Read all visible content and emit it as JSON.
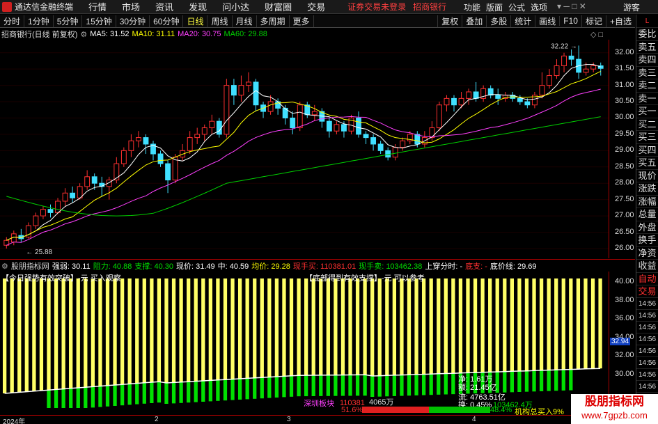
{
  "titlebar": {
    "app_name": "通达信金融终端",
    "menus": [
      "行情",
      "市场",
      "资讯",
      "发现",
      "问小达",
      "财富圈",
      "交易"
    ],
    "notice1": "证券交易未登录",
    "notice2": "招商银行",
    "right_menus": [
      "功能",
      "版面",
      "公式",
      "选项"
    ],
    "guest": "游客"
  },
  "toolbar": {
    "periods": [
      "分时",
      "1分钟",
      "5分钟",
      "15分钟",
      "30分钟",
      "60分钟",
      "日线",
      "周线",
      "月线",
      "多周期",
      "更多"
    ],
    "active_period": "日线",
    "tools": [
      "复权",
      "叠加",
      "多股",
      "统计",
      "画线",
      "F10",
      "标记",
      "+自选"
    ]
  },
  "stock": {
    "title": "招商银行(日线 前复权)",
    "ma5_label": "MA5: 31.52",
    "ma10_label": "MA10: 31.11",
    "ma20_label": "MA20: 30.75",
    "ma60_label": "MA60: 29.88",
    "high_mark": "32.22",
    "low_mark": "25.88"
  },
  "colors": {
    "ma5": "#ffffff",
    "ma10": "#ffff00",
    "ma20": "#ff40ff",
    "ma60": "#00d000",
    "up": "#ff3030",
    "down": "#40e0ff",
    "bar_yellow": "#ffff66",
    "bar_green": "#00e000"
  },
  "price_axis": [
    "32.00",
    "31.50",
    "31.00",
    "30.50",
    "30.00",
    "29.50",
    "29.00",
    "28.50",
    "28.00",
    "27.50",
    "27.00",
    "26.50",
    "26.00"
  ],
  "indicator": {
    "name": "股朋指标网",
    "items": [
      {
        "text": "强弱: 30.11",
        "color": "#ffffff"
      },
      {
        "text": "阻力: 40.88",
        "color": "#00e000"
      },
      {
        "text": "支撑: 40.30",
        "color": "#00e000"
      },
      {
        "text": "现价: 31.49",
        "color": "#ffffff"
      },
      {
        "text": "中: 40.59",
        "color": "#ffffff"
      },
      {
        "text": "均价: 29.28",
        "color": "#ffff00"
      },
      {
        "text": "现手买: 110381.01",
        "color": "#ff3030"
      },
      {
        "text": "现手卖: 103462.38",
        "color": "#00e000"
      },
      {
        "text": "上穿分时: -",
        "color": "#ffffff"
      },
      {
        "text": "底支: -",
        "color": "#ff3030"
      },
      {
        "text": "底价线: 29.69",
        "color": "#ffffff"
      }
    ],
    "caption_left": "【今日强势有效突破】-元 买入观察",
    "caption_right": "【底部得到有效支撑】-元 可以参考",
    "current_value": "32.94",
    "axis": [
      "40.00",
      "38.00",
      "36.00",
      "34.00",
      "32.00",
      "30.00"
    ]
  },
  "overlay": {
    "line1": "净: 1.61万",
    "line2": "额: 21.45亿",
    "line3": "流: 4763.51亿",
    "line4": "换: 0.45%",
    "vol_sell": "103462.4万",
    "sector": "深圳板块",
    "buy_num": "110381",
    "vol_mid": "4065万",
    "pct_buy": "51.6%",
    "pct_sell": "48.4%",
    "inst": "机构总买入9%"
  },
  "side_panel": {
    "top_label": "L",
    "items": [
      "委比",
      "卖五",
      "卖四",
      "卖三",
      "卖二",
      "卖一",
      "买一",
      "买二",
      "买三",
      "买四",
      "买五",
      "现价",
      "涨跌",
      "涨幅",
      "总量",
      "外盘",
      "换手",
      "净资",
      "收益",
      "自动",
      "交易"
    ],
    "times": [
      "14:56",
      "14:56",
      "14:56",
      "14:56",
      "14:56",
      "14:56",
      "14:56",
      "14:56"
    ]
  },
  "bottom": {
    "year": "2024年",
    "months": [
      "2",
      "3",
      "4"
    ]
  },
  "watermark": {
    "line1": "股朋指标网",
    "line2": "www.7gpzb.com"
  },
  "chart_data": {
    "type": "candlestick",
    "ylim": [
      25.7,
      32.4
    ],
    "candles": [
      [
        26.1,
        26.25,
        26.0,
        26.35
      ],
      [
        26.2,
        26.45,
        26.1,
        26.55
      ],
      [
        26.4,
        26.3,
        26.2,
        26.6
      ],
      [
        26.35,
        26.7,
        26.3,
        26.8
      ],
      [
        26.7,
        27.0,
        26.6,
        27.1
      ],
      [
        27.0,
        27.2,
        26.9,
        27.3
      ],
      [
        27.2,
        27.1,
        26.95,
        27.35
      ],
      [
        27.1,
        27.45,
        27.05,
        27.55
      ],
      [
        27.45,
        27.7,
        27.3,
        27.85
      ],
      [
        27.7,
        27.55,
        27.4,
        27.9
      ],
      [
        27.55,
        27.9,
        27.5,
        28.0
      ],
      [
        27.9,
        28.2,
        27.8,
        28.4
      ],
      [
        28.2,
        28.0,
        27.8,
        28.3
      ],
      [
        28.0,
        27.9,
        27.6,
        28.2
      ],
      [
        27.9,
        28.1,
        27.5,
        28.2
      ],
      [
        28.1,
        28.6,
        28.0,
        28.8
      ],
      [
        28.6,
        29.0,
        28.5,
        29.1
      ],
      [
        29.0,
        29.3,
        28.8,
        29.5
      ],
      [
        29.3,
        29.4,
        29.1,
        29.6
      ],
      [
        29.4,
        29.2,
        28.9,
        29.5
      ],
      [
        29.2,
        28.9,
        28.7,
        29.3
      ],
      [
        28.9,
        28.6,
        28.5,
        29.0
      ],
      [
        28.6,
        28.1,
        27.7,
        28.7
      ],
      [
        28.1,
        28.8,
        28.0,
        28.9
      ],
      [
        28.8,
        29.0,
        28.7,
        29.2
      ],
      [
        29.0,
        29.4,
        28.9,
        29.6
      ],
      [
        29.4,
        29.5,
        29.2,
        29.7
      ],
      [
        29.5,
        29.7,
        29.3,
        29.8
      ],
      [
        29.7,
        29.9,
        29.5,
        30.1
      ],
      [
        29.9,
        29.5,
        29.4,
        30.0
      ],
      [
        29.5,
        31.0,
        29.4,
        31.2
      ],
      [
        31.0,
        30.7,
        30.4,
        31.2
      ],
      [
        30.7,
        31.0,
        30.5,
        31.3
      ],
      [
        31.0,
        31.1,
        30.8,
        31.4
      ],
      [
        31.1,
        30.4,
        30.2,
        31.2
      ],
      [
        30.4,
        30.2,
        30.0,
        30.5
      ],
      [
        30.2,
        30.5,
        30.1,
        30.7
      ],
      [
        30.5,
        30.3,
        30.1,
        30.6
      ],
      [
        30.3,
        30.0,
        29.8,
        30.4
      ],
      [
        30.0,
        29.7,
        29.5,
        30.2
      ],
      [
        29.7,
        30.4,
        29.6,
        30.5
      ],
      [
        30.4,
        30.1,
        30.0,
        30.5
      ],
      [
        30.1,
        30.2,
        29.9,
        30.4
      ],
      [
        30.2,
        29.9,
        29.7,
        30.3
      ],
      [
        29.9,
        29.6,
        29.4,
        30.0
      ],
      [
        29.6,
        29.8,
        29.5,
        29.9
      ],
      [
        29.8,
        29.6,
        29.4,
        29.9
      ],
      [
        29.6,
        30.0,
        29.5,
        30.1
      ],
      [
        30.0,
        29.5,
        29.4,
        30.2
      ],
      [
        29.5,
        29.4,
        29.2,
        29.6
      ],
      [
        29.4,
        29.2,
        29.0,
        29.5
      ],
      [
        29.2,
        29.0,
        28.9,
        29.3
      ],
      [
        29.0,
        28.8,
        28.7,
        29.1
      ],
      [
        28.8,
        29.1,
        28.7,
        29.2
      ],
      [
        29.1,
        29.3,
        29.0,
        29.4
      ],
      [
        29.3,
        29.5,
        29.2,
        29.6
      ],
      [
        29.5,
        29.2,
        29.1,
        29.6
      ],
      [
        29.2,
        29.4,
        29.1,
        29.6
      ],
      [
        29.4,
        29.7,
        29.3,
        29.9
      ],
      [
        29.7,
        30.4,
        29.6,
        30.5
      ],
      [
        30.4,
        30.6,
        30.2,
        30.7
      ],
      [
        30.6,
        30.4,
        30.2,
        30.7
      ],
      [
        30.4,
        30.6,
        30.3,
        30.8
      ],
      [
        30.6,
        30.8,
        30.4,
        30.9
      ],
      [
        30.8,
        30.6,
        30.5,
        31.1
      ],
      [
        30.6,
        30.9,
        30.5,
        31.0
      ],
      [
        30.9,
        30.7,
        30.6,
        31.0
      ],
      [
        30.7,
        30.6,
        30.4,
        30.9
      ],
      [
        30.6,
        30.7,
        30.5,
        30.8
      ],
      [
        30.7,
        30.6,
        30.5,
        30.8
      ],
      [
        30.6,
        30.5,
        30.4,
        30.7
      ],
      [
        30.5,
        30.4,
        30.3,
        30.6
      ],
      [
        30.4,
        30.7,
        30.3,
        30.8
      ],
      [
        30.7,
        31.0,
        30.6,
        31.4
      ],
      [
        31.0,
        31.3,
        30.9,
        31.5
      ],
      [
        31.3,
        31.6,
        31.2,
        31.8
      ],
      [
        31.6,
        31.9,
        31.4,
        32.0
      ],
      [
        31.9,
        31.8,
        31.6,
        32.1
      ],
      [
        31.8,
        31.4,
        31.2,
        32.22
      ],
      [
        31.4,
        31.5,
        31.3,
        31.7
      ],
      [
        31.5,
        31.6,
        31.4,
        31.7
      ],
      [
        31.6,
        31.52,
        31.3,
        31.7
      ]
    ]
  }
}
